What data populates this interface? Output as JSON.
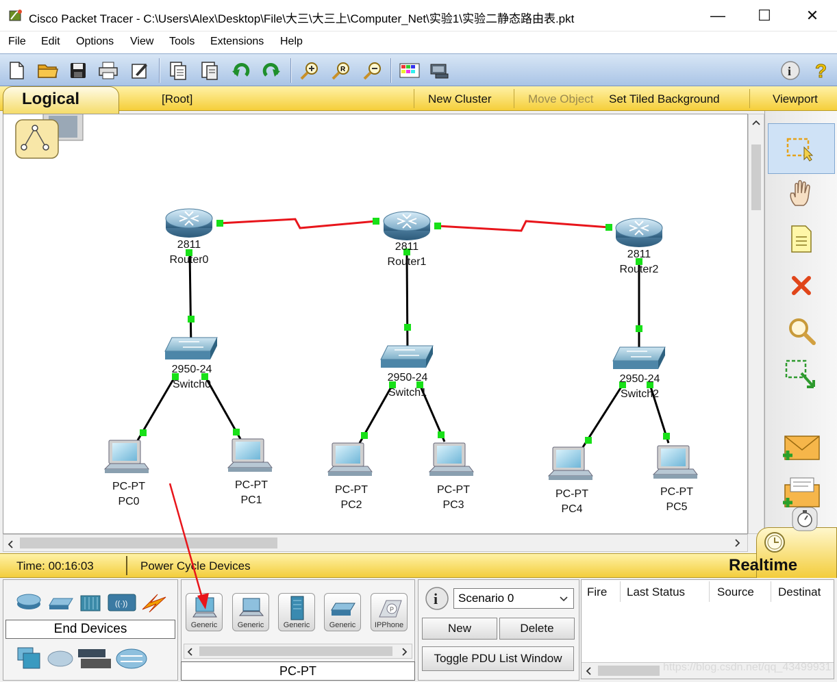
{
  "window": {
    "title": "Cisco Packet Tracer - C:\\Users\\Alex\\Desktop\\File\\大三\\大三上\\Computer_Net\\实验1\\实验二静态路由表.pkt",
    "minimize": "—",
    "maximize": "☐",
    "close": "✕"
  },
  "menu": [
    "File",
    "Edit",
    "Options",
    "View",
    "Tools",
    "Extensions",
    "Help"
  ],
  "logical_bar": {
    "tab_label": "Logical",
    "root": "[Root]",
    "new_cluster": "New Cluster",
    "move_object": "Move Object",
    "set_tiled_background": "Set Tiled Background",
    "viewport": "Viewport"
  },
  "topology": {
    "routers": [
      {
        "model": "2811",
        "name": "Router0"
      },
      {
        "model": "2811",
        "name": "Router1"
      },
      {
        "model": "2811",
        "name": "Router2"
      }
    ],
    "switches": [
      {
        "model": "2950-24",
        "name": "Switch0"
      },
      {
        "model": "2950-24",
        "name": "Switch1"
      },
      {
        "model": "2950-24",
        "name": "Switch2"
      }
    ],
    "pcs": [
      {
        "model": "PC-PT",
        "name": "PC0"
      },
      {
        "model": "PC-PT",
        "name": "PC1"
      },
      {
        "model": "PC-PT",
        "name": "PC2"
      },
      {
        "model": "PC-PT",
        "name": "PC3"
      },
      {
        "model": "PC-PT",
        "name": "PC4"
      },
      {
        "model": "PC-PT",
        "name": "PC5"
      }
    ],
    "colors": {
      "serial_link": "#e8151b",
      "ethernet_link": "#000000",
      "port_up": "#18e018"
    }
  },
  "status": {
    "time": "Time: 00:16:03",
    "power_cycle": "Power Cycle Devices",
    "mode": "Realtime"
  },
  "device_panel": {
    "category": "End Devices",
    "subcategory_label": "PC-PT",
    "devices": [
      "Generic",
      "Generic",
      "Generic",
      "Generic",
      "IPPhone"
    ]
  },
  "scenario": {
    "info_icon": "i",
    "selected": "Scenario 0",
    "new": "New",
    "delete": "Delete",
    "toggle": "Toggle PDU List Window"
  },
  "pdu_list": {
    "columns": [
      "Fire",
      "Last Status",
      "Source",
      "Destinat"
    ]
  },
  "watermark": "https://blog.csdn.net/qq_43499931"
}
